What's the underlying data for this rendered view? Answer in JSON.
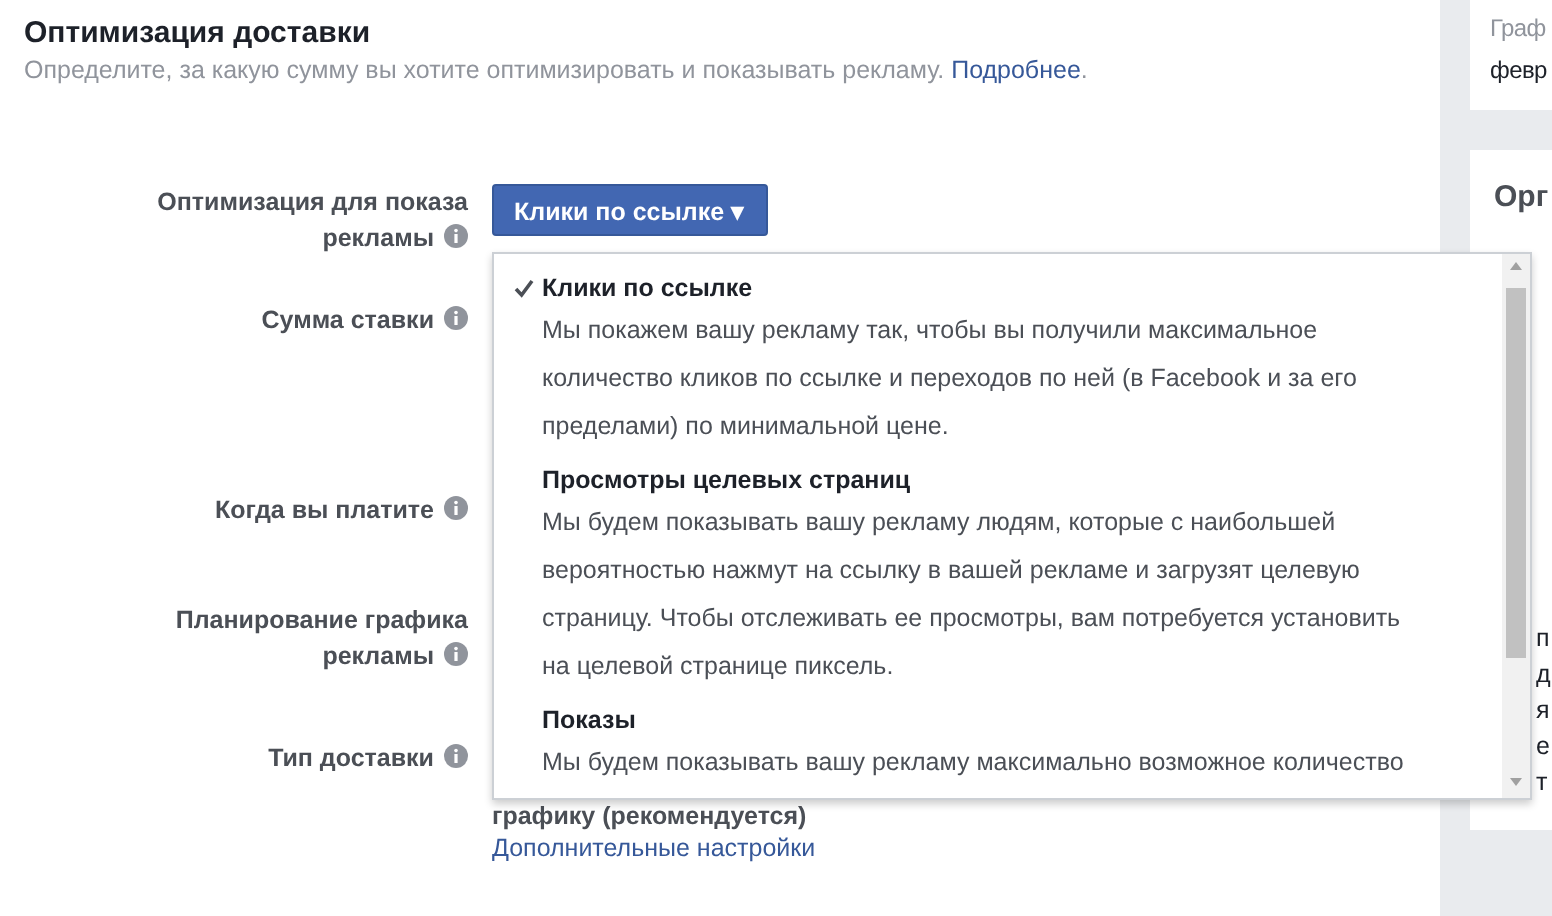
{
  "section": {
    "title": "Оптимизация доставки",
    "subtitle": "Определите, за какую сумму вы хотите оптимизировать и показывать рекламу.",
    "link": "Подробнее",
    "link_suffix": "."
  },
  "fields": [
    {
      "label": [
        "Оптимизация для показа",
        "рекламы"
      ]
    },
    {
      "label": [
        "Сумма ставки"
      ]
    },
    {
      "label": [
        "Когда вы платите"
      ]
    },
    {
      "label": [
        "Планирование графика",
        "рекламы"
      ]
    },
    {
      "label": [
        "Тип доставки"
      ]
    }
  ],
  "dropdown_button": {
    "label": "Клики по ссылке",
    "caret": "▾"
  },
  "dropdown_menu": {
    "items": [
      {
        "title": "Клики по ссылке",
        "selected": true,
        "description": [
          "Мы покажем вашу рекламу так, чтобы вы получили максимальное",
          "количество кликов по ссылке и переходов по ней (в Facebook и за его",
          "пределами) по минимальной цене."
        ]
      },
      {
        "title": "Просмотры целевых страниц",
        "selected": false,
        "description": [
          "Мы будем показывать вашу рекламу людям, которые с наибольшей",
          "вероятностью нажмут на ссылку в вашей рекламе и загрузят целевую",
          "страницу. Чтобы отслеживать ее просмотры, вам потребуется установить",
          "на целевой странице пиксель."
        ]
      },
      {
        "title": "Показы",
        "selected": false,
        "description": [
          "Мы будем показывать вашу рекламу максимально возможное количество"
        ]
      }
    ]
  },
  "delivery_note": "графику (рекомендуется)",
  "advanced_link": "Дополнительные настройки",
  "right_panel": {
    "card_1": {
      "label": "Граф",
      "value": "февр"
    },
    "card_2": {
      "title": "Орг",
      "fragments": [
        "п",
        "д",
        "я",
        "е",
        "т"
      ]
    }
  }
}
